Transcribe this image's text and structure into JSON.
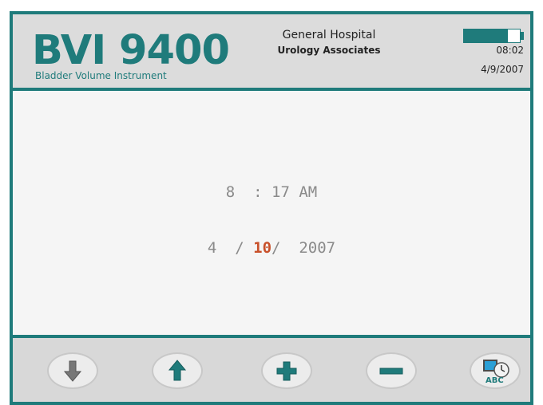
{
  "header": {
    "logo_title": "BVI 9400",
    "logo_subtitle": "Bladder Volume Instrument",
    "hospital": "General Hospital",
    "practice": "Urology Associates",
    "clock": "08:02",
    "date": "4/9/2007",
    "battery_level": 0.78
  },
  "editor": {
    "time": {
      "hour": "8",
      "sep": ":",
      "minute": "17",
      "ampm": "AM"
    },
    "date": {
      "month": "4",
      "sep1": "/",
      "day": "10",
      "sep2": "/",
      "year": "2007"
    }
  },
  "footer": {
    "buttons": [
      {
        "name": "down-arrow-icon"
      },
      {
        "name": "up-arrow-icon"
      },
      {
        "name": "plus-icon"
      },
      {
        "name": "minus-icon"
      },
      {
        "name": "clock-abc-icon",
        "label": "ABC"
      }
    ]
  },
  "colors": {
    "teal": "#1f7b7b",
    "highlight": "#c8502a",
    "text_gray": "#8a8a8a"
  }
}
